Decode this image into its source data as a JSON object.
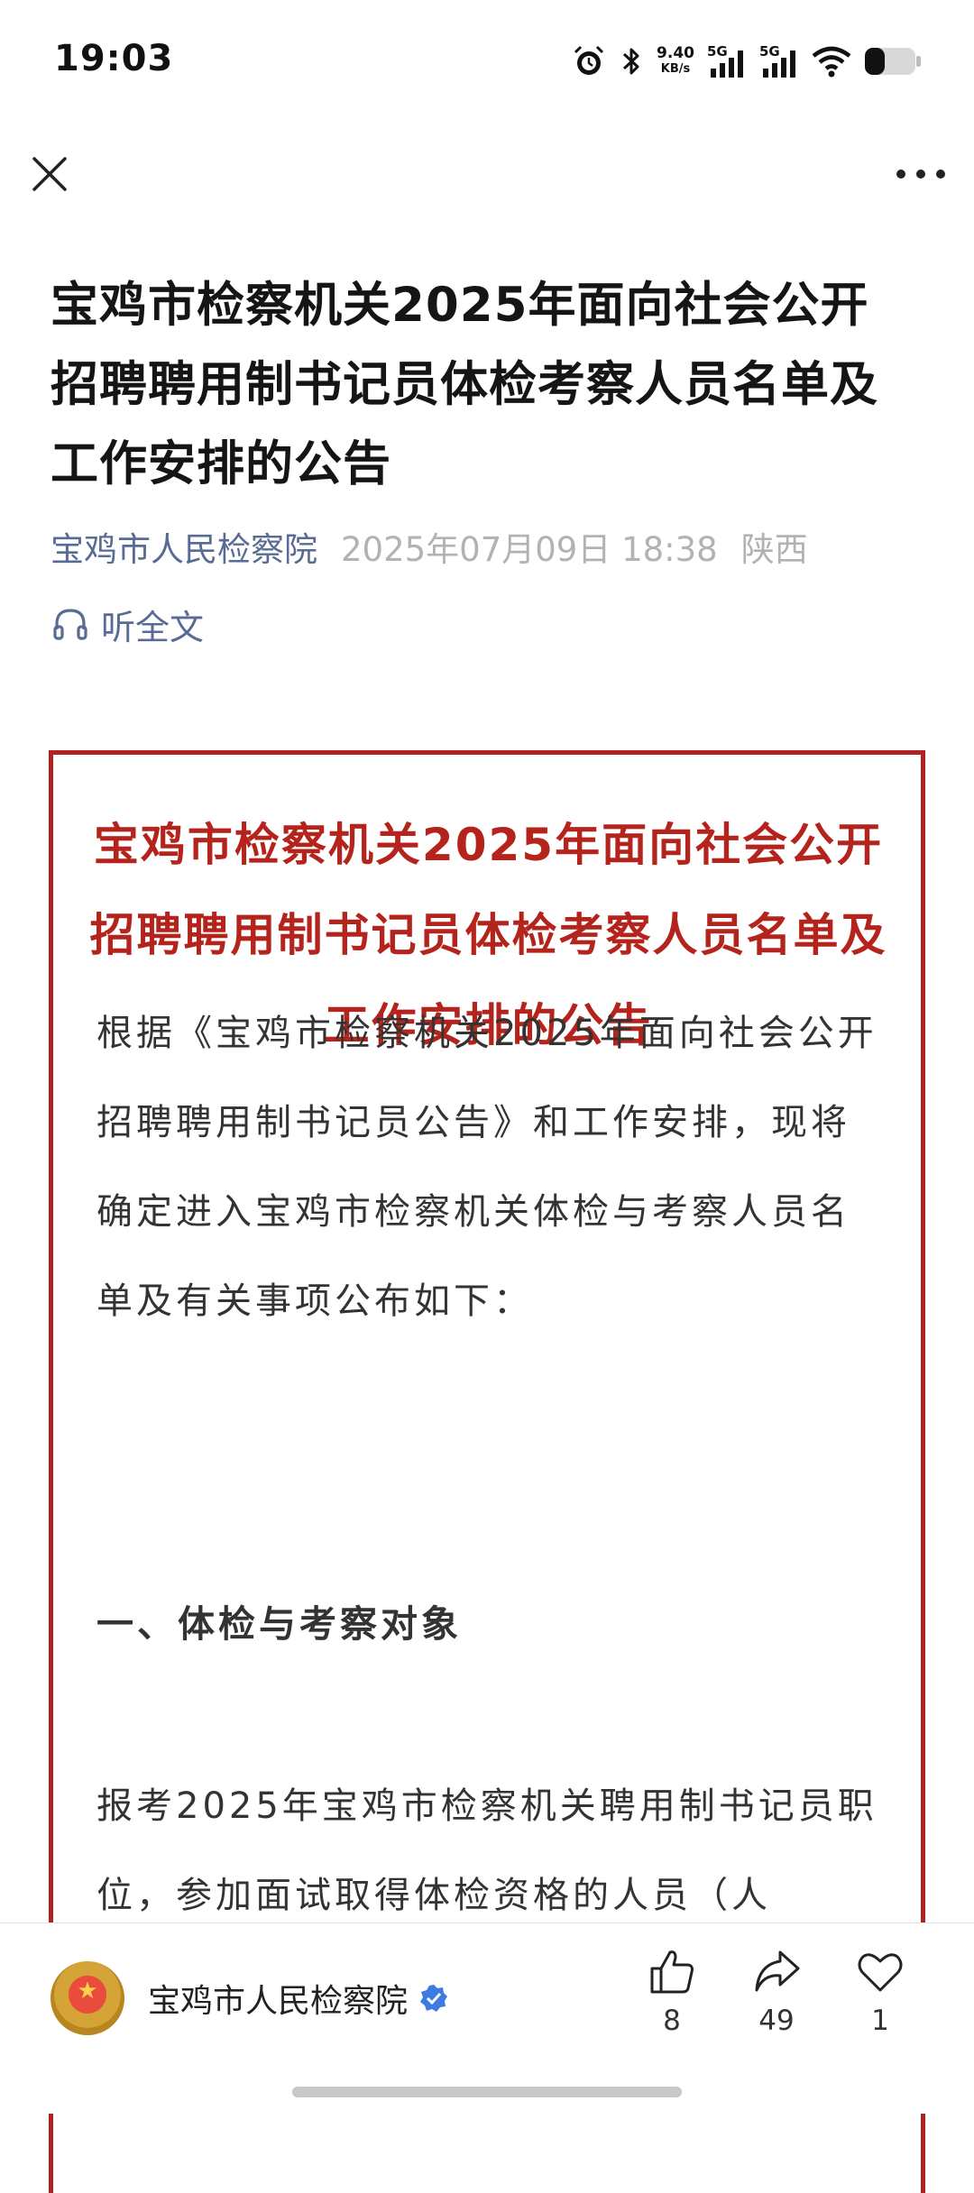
{
  "status_bar": {
    "time": "19:03",
    "net_speed_value": "9.40",
    "net_speed_unit": "KB/s",
    "sim1_label": "5G",
    "sim2_label": "5G",
    "icons": [
      "alarm-icon",
      "bluetooth-icon",
      "signal-icon",
      "signal-icon",
      "wifi-icon",
      "battery-icon"
    ]
  },
  "nav": {
    "close_icon": "close-icon",
    "more_icon": "more-icon"
  },
  "article": {
    "title": "宝鸡市检察机关2025年面向社会公开招聘聘用制书记员体检考察人员名单及工作安排的公告",
    "author": "宝鸡市人民检察院",
    "date": "2025年07月09日 18:38",
    "region": "陕西",
    "listen_label": "听全文"
  },
  "content": {
    "heading": "宝鸡市检察机关2025年面向社会公开招聘聘用制书记员体检考察人员名单及工作安排的公告",
    "intro": "根据《宝鸡市检察机关2025年面向社会公开招聘聘用制书记员公告》和工作安排，现将确定进入宝鸡市检察机关体检与考察人员名单及有关事项公布如下：",
    "section1_title": "一、体检与考察对象",
    "section1_body": "报考2025年宝鸡市检察机关聘用制书记员职位，参加面试取得体检资格的人员（人"
  },
  "bottom_bar": {
    "account_name": "宝鸡市人民检察院",
    "like_count": "8",
    "share_count": "49",
    "favorite_count": "1"
  },
  "colors": {
    "accent_blue": "#576b95",
    "frame_red": "#b22222",
    "title_red": "#b5241c",
    "meta_gray": "#b2b2b2"
  }
}
